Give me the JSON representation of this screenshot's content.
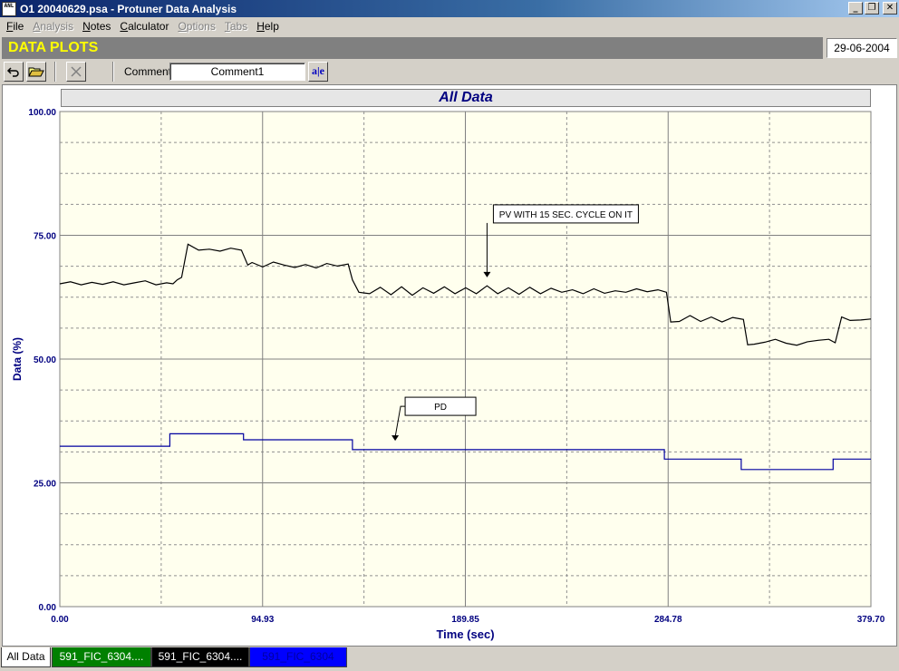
{
  "window": {
    "app_icon": "ANL",
    "title": "O1 20040629.psa - Protuner Data  Analysis",
    "controls": {
      "minimize": "_",
      "restore": "❐",
      "close": "✕"
    }
  },
  "menu": [
    {
      "label": "File",
      "enabled": true
    },
    {
      "label": "Analysis",
      "enabled": false
    },
    {
      "label": "Notes",
      "enabled": true
    },
    {
      "label": "Calculator",
      "enabled": true
    },
    {
      "label": "Options",
      "enabled": false
    },
    {
      "label": "Tabs",
      "enabled": false
    },
    {
      "label": "Help",
      "enabled": true
    }
  ],
  "header": {
    "title": "DATA PLOTS",
    "date": "29-06-2004",
    "title_color": "#ffff00",
    "bar_color": "#808080"
  },
  "toolbar": {
    "undo_icon": "undo-icon",
    "open_icon": "folder-open-icon",
    "delete_icon": "delete-x-icon",
    "comment_label": "Comment",
    "comment_value": "Comment1",
    "spell_label": "a|e"
  },
  "chart_data": {
    "type": "line",
    "title": "All Data",
    "xlabel": "Time (sec)",
    "ylabel": "Data (%)",
    "xlim": [
      0,
      379.7
    ],
    "ylim": [
      0,
      100
    ],
    "x_ticks": [
      "0.00",
      "94.93",
      "189.85",
      "284.78",
      "379.70"
    ],
    "y_ticks": [
      "0.00",
      "25.00",
      "50.00",
      "75.00",
      "100.00"
    ],
    "grid": true,
    "background": "#ffffee",
    "annotations": [
      {
        "text": "PV WITH 15 SEC. CYCLE ON IT",
        "target": [
          200,
          66.5
        ]
      },
      {
        "text": "PD",
        "target": [
          157,
          33.5
        ]
      }
    ],
    "series": [
      {
        "color": "#000000",
        "x": [
          0,
          5,
          10,
          15,
          20,
          25,
          30,
          35,
          40,
          45,
          50,
          53,
          55,
          57,
          60,
          65,
          70,
          75,
          80,
          85,
          88,
          90,
          95,
          100,
          105,
          110,
          115,
          120,
          125,
          130,
          135,
          137,
          140,
          145,
          150,
          155,
          160,
          165,
          170,
          175,
          180,
          185,
          190,
          195,
          200,
          205,
          210,
          215,
          220,
          225,
          230,
          235,
          240,
          245,
          250,
          255,
          260,
          265,
          270,
          275,
          280,
          284,
          286,
          290,
          295,
          300,
          305,
          310,
          315,
          320,
          322,
          325,
          330,
          335,
          340,
          345,
          350,
          355,
          360,
          363,
          366,
          370,
          375,
          379.7
        ],
        "y": [
          65.2,
          65.6,
          65.0,
          65.5,
          65.1,
          65.6,
          65.0,
          65.4,
          65.8,
          65.0,
          65.4,
          65.2,
          66.0,
          66.5,
          73.2,
          72.0,
          72.2,
          71.8,
          72.4,
          72.0,
          69.0,
          69.5,
          68.6,
          69.6,
          69.0,
          68.5,
          69.1,
          68.4,
          69.3,
          68.8,
          69.2,
          66.0,
          63.5,
          63.2,
          64.5,
          63.0,
          64.6,
          62.9,
          64.4,
          63.3,
          64.6,
          63.2,
          64.4,
          63.2,
          64.8,
          63.2,
          64.4,
          63.1,
          64.5,
          63.2,
          64.3,
          63.5,
          64.0,
          63.2,
          64.2,
          63.3,
          63.8,
          63.5,
          64.2,
          63.6,
          64.0,
          63.5,
          57.5,
          57.6,
          58.8,
          57.6,
          58.5,
          57.5,
          58.4,
          58.0,
          52.9,
          53.0,
          53.4,
          54.0,
          53.2,
          52.8,
          53.5,
          53.8,
          54.0,
          53.3,
          58.5,
          57.8,
          57.9,
          58.1
        ]
      },
      {
        "color": "#0000a0",
        "x": [
          0,
          51.5,
          51.5,
          86,
          86,
          137,
          137,
          283,
          283,
          319,
          319,
          362,
          362,
          379.7
        ],
        "y": [
          32.4,
          32.4,
          34.9,
          34.9,
          33.7,
          33.7,
          31.7,
          31.7,
          29.8,
          29.8,
          27.7,
          27.7,
          29.8,
          29.8
        ]
      }
    ]
  },
  "tabs": [
    {
      "label": "All Data",
      "bg": "#ffffff",
      "fg": "#000000"
    },
    {
      "label": "591_FIC_6304....",
      "bg": "#008000",
      "fg": "#ffffff"
    },
    {
      "label": "591_FIC_6304....",
      "bg": "#000000",
      "fg": "#ffffff"
    },
    {
      "label": "591_FIC_6304",
      "bg": "#0000ff",
      "fg": "#0000a0"
    }
  ]
}
